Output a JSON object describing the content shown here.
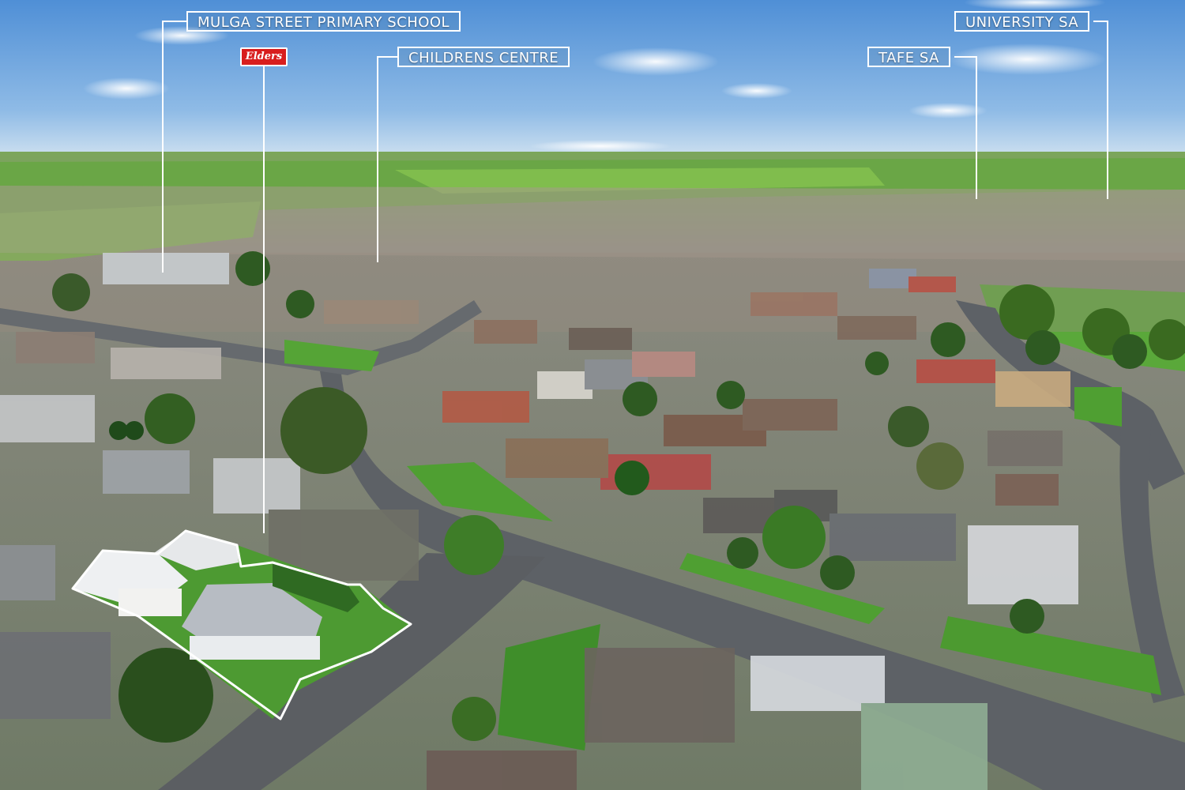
{
  "callouts": {
    "primary_school": "MULGA STREET PRIMARY SCHOOL",
    "childrens_centre": "CHILDRENS CENTRE",
    "tafe": "TAFE SA",
    "university": "UNIVERSITY SA"
  },
  "logo": {
    "text": "Elders",
    "color": "#d81e1e"
  },
  "colors": {
    "sky_top": "#5a95d8",
    "sky_horizon": "#c9def0",
    "pasture": "#6fb444",
    "lawn": "#4f9a34",
    "road": "#5b5e63",
    "boundary_outline": "#ffffff"
  }
}
